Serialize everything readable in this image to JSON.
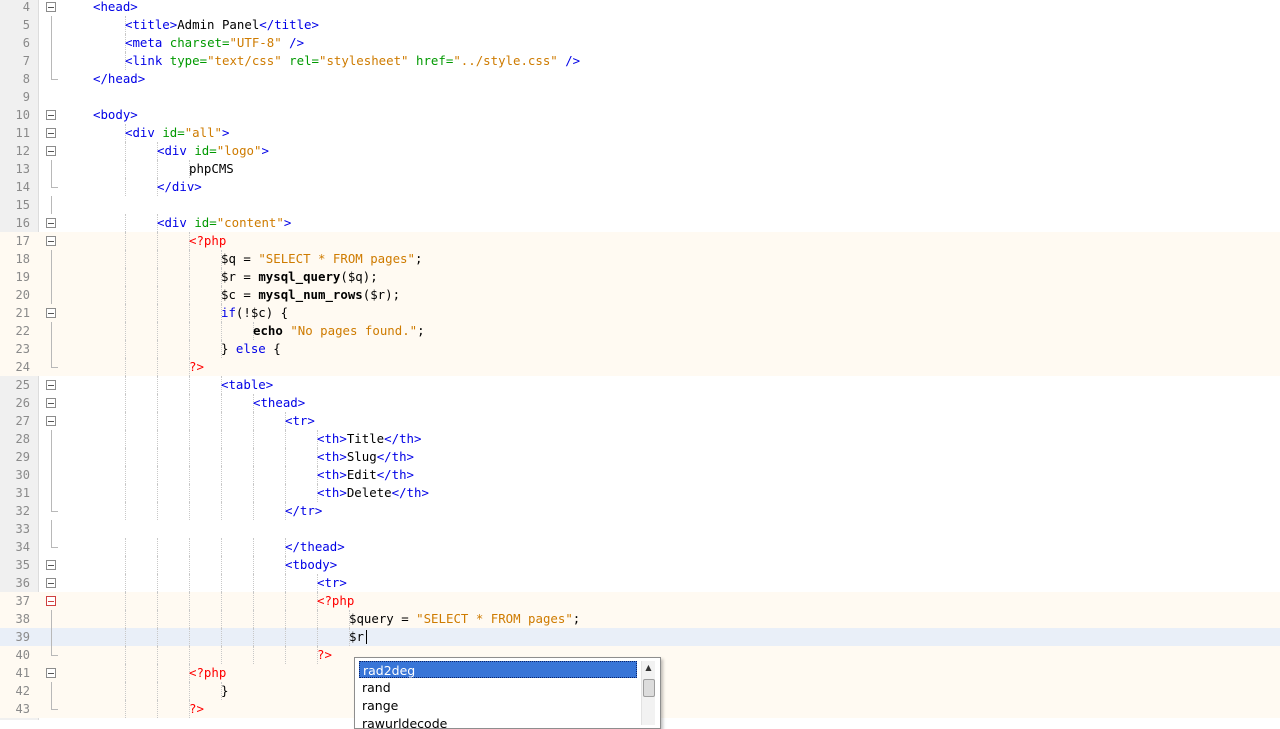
{
  "editor": {
    "lines": [
      {
        "n": "4",
        "i": 1,
        "f": "open",
        "t": [
          [
            "tag",
            "<head>"
          ]
        ]
      },
      {
        "n": "5",
        "i": 2,
        "f": "line",
        "t": [
          [
            "tag",
            "<title>"
          ],
          [
            "txt",
            "Admin Panel"
          ],
          [
            "tag",
            "</title>"
          ]
        ]
      },
      {
        "n": "6",
        "i": 2,
        "f": "line",
        "t": [
          [
            "tag",
            "<meta "
          ],
          [
            "attr",
            "charset="
          ],
          [
            "str",
            "\"UTF-8\""
          ],
          [
            "tag",
            " />"
          ]
        ]
      },
      {
        "n": "7",
        "i": 2,
        "f": "line",
        "t": [
          [
            "tag",
            "<link "
          ],
          [
            "attr",
            "type="
          ],
          [
            "str",
            "\"text/css\""
          ],
          [
            "txt",
            " "
          ],
          [
            "attr",
            "rel="
          ],
          [
            "str",
            "\"stylesheet\""
          ],
          [
            "txt",
            " "
          ],
          [
            "attr",
            "href="
          ],
          [
            "str",
            "\"../style.css\""
          ],
          [
            "tag",
            " />"
          ]
        ]
      },
      {
        "n": "8",
        "i": 1,
        "f": "end",
        "t": [
          [
            "tag",
            "</head>"
          ]
        ]
      },
      {
        "n": "9",
        "i": 0,
        "f": "",
        "t": []
      },
      {
        "n": "10",
        "i": 1,
        "f": "open",
        "t": [
          [
            "tag",
            "<body>"
          ]
        ]
      },
      {
        "n": "11",
        "i": 2,
        "f": "open",
        "t": [
          [
            "tag",
            "<div "
          ],
          [
            "attr",
            "id="
          ],
          [
            "str",
            "\"all\""
          ],
          [
            "tag",
            ">"
          ]
        ]
      },
      {
        "n": "12",
        "i": 3,
        "f": "open",
        "t": [
          [
            "tag",
            "<div "
          ],
          [
            "attr",
            "id="
          ],
          [
            "str",
            "\"logo\""
          ],
          [
            "tag",
            ">"
          ]
        ]
      },
      {
        "n": "13",
        "i": 4,
        "f": "line",
        "t": [
          [
            "txt",
            "phpCMS"
          ]
        ]
      },
      {
        "n": "14",
        "i": 3,
        "f": "end",
        "t": [
          [
            "tag",
            "</div>"
          ]
        ]
      },
      {
        "n": "15",
        "i": 0,
        "f": "line",
        "t": []
      },
      {
        "n": "16",
        "i": 3,
        "f": "open",
        "t": [
          [
            "tag",
            "<div "
          ],
          [
            "attr",
            "id="
          ],
          [
            "str",
            "\"content\""
          ],
          [
            "tag",
            ">"
          ]
        ]
      },
      {
        "n": "17",
        "i": 4,
        "f": "open",
        "php": true,
        "t": [
          [
            "phptag",
            "<?php"
          ]
        ]
      },
      {
        "n": "18",
        "i": 5,
        "f": "line",
        "php": true,
        "t": [
          [
            "var",
            "$q = "
          ],
          [
            "pstr",
            "\"SELECT * FROM pages\""
          ],
          [
            "var",
            ";"
          ]
        ]
      },
      {
        "n": "19",
        "i": 5,
        "f": "line",
        "php": true,
        "t": [
          [
            "var",
            "$r = "
          ],
          [
            "fn",
            "mysql_query"
          ],
          [
            "var",
            "($q);"
          ]
        ]
      },
      {
        "n": "20",
        "i": 5,
        "f": "line",
        "php": true,
        "t": [
          [
            "var",
            "$c = "
          ],
          [
            "fn",
            "mysql_num_rows"
          ],
          [
            "var",
            "($r);"
          ]
        ]
      },
      {
        "n": "21",
        "i": 5,
        "f": "open",
        "php": true,
        "t": [
          [
            "kw",
            "if"
          ],
          [
            "var",
            "(!$c) {"
          ]
        ]
      },
      {
        "n": "22",
        "i": 6,
        "f": "line",
        "php": true,
        "t": [
          [
            "fn",
            "echo"
          ],
          [
            "var",
            " "
          ],
          [
            "pstr",
            "\"No pages found.\""
          ],
          [
            "var",
            ";"
          ]
        ]
      },
      {
        "n": "23",
        "i": 5,
        "f": "line",
        "php": true,
        "t": [
          [
            "var",
            "} "
          ],
          [
            "kw",
            "else"
          ],
          [
            "var",
            " {"
          ]
        ]
      },
      {
        "n": "24",
        "i": 4,
        "f": "end",
        "php": true,
        "t": [
          [
            "phptag",
            "?>"
          ]
        ]
      },
      {
        "n": "25",
        "i": 5,
        "f": "open",
        "t": [
          [
            "tag",
            "<table>"
          ]
        ]
      },
      {
        "n": "26",
        "i": 6,
        "f": "open",
        "t": [
          [
            "tag",
            "<thead>"
          ]
        ]
      },
      {
        "n": "27",
        "i": 7,
        "f": "open",
        "t": [
          [
            "tag",
            "<tr>"
          ]
        ]
      },
      {
        "n": "28",
        "i": 8,
        "f": "line",
        "t": [
          [
            "tag",
            "<th>"
          ],
          [
            "txt",
            "Title"
          ],
          [
            "tag",
            "</th>"
          ]
        ]
      },
      {
        "n": "29",
        "i": 8,
        "f": "line",
        "t": [
          [
            "tag",
            "<th>"
          ],
          [
            "txt",
            "Slug"
          ],
          [
            "tag",
            "</th>"
          ]
        ]
      },
      {
        "n": "30",
        "i": 8,
        "f": "line",
        "t": [
          [
            "tag",
            "<th>"
          ],
          [
            "txt",
            "Edit"
          ],
          [
            "tag",
            "</th>"
          ]
        ]
      },
      {
        "n": "31",
        "i": 8,
        "f": "line",
        "t": [
          [
            "tag",
            "<th>"
          ],
          [
            "txt",
            "Delete"
          ],
          [
            "tag",
            "</th>"
          ]
        ]
      },
      {
        "n": "32",
        "i": 7,
        "f": "end",
        "t": [
          [
            "tag",
            "</tr>"
          ]
        ]
      },
      {
        "n": "33",
        "i": 0,
        "f": "line",
        "t": []
      },
      {
        "n": "34",
        "i": 7,
        "f": "end",
        "t": [
          [
            "tag",
            "</thead>"
          ]
        ]
      },
      {
        "n": "35",
        "i": 7,
        "f": "open",
        "t": [
          [
            "tag",
            "<tbody>"
          ]
        ]
      },
      {
        "n": "36",
        "i": 8,
        "f": "open",
        "t": [
          [
            "tag",
            "<tr>"
          ]
        ]
      },
      {
        "n": "37",
        "i": 8,
        "f": "err",
        "php": true,
        "t": [
          [
            "phptag",
            "<?php"
          ]
        ]
      },
      {
        "n": "38",
        "i": 9,
        "f": "line",
        "php": true,
        "t": [
          [
            "var",
            "$query = "
          ],
          [
            "pstr",
            "\"SELECT * FROM pages\""
          ],
          [
            "var",
            ";"
          ]
        ]
      },
      {
        "n": "39",
        "i": 9,
        "f": "line",
        "php": true,
        "current": true,
        "caret": true,
        "t": [
          [
            "var",
            "$r"
          ]
        ]
      },
      {
        "n": "40",
        "i": 8,
        "f": "end",
        "php": true,
        "t": [
          [
            "phptag",
            "?>"
          ]
        ]
      },
      {
        "n": "41",
        "i": 4,
        "f": "open",
        "php": true,
        "t": [
          [
            "phptag",
            "<?php"
          ]
        ]
      },
      {
        "n": "42",
        "i": 5,
        "f": "line",
        "php": true,
        "t": [
          [
            "var",
            "}"
          ]
        ]
      },
      {
        "n": "43",
        "i": 4,
        "f": "end",
        "php": true,
        "t": [
          [
            "phptag",
            "?>"
          ]
        ]
      }
    ]
  },
  "autocomplete": {
    "items": [
      "rad2deg",
      "rand",
      "range",
      "rawurldecode"
    ],
    "selected_index": 0
  }
}
